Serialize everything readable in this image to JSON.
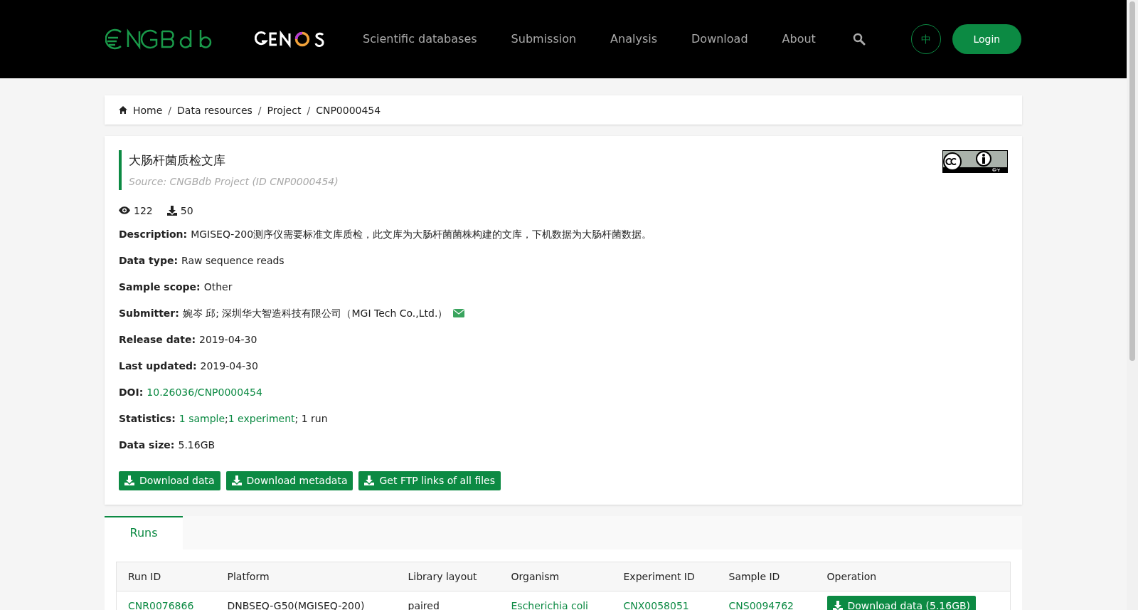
{
  "header": {
    "nav": [
      "Scientific databases",
      "Submission",
      "Analysis",
      "Download",
      "About"
    ],
    "language": "中",
    "login": "Login"
  },
  "breadcrumb": [
    "Home",
    "Data resources",
    "Project",
    "CNP0000454"
  ],
  "breadcrumb_separator": "/",
  "project": {
    "title": "大肠杆菌质检文库",
    "source": "Source: CNGBdb Project (ID CNP0000454)",
    "views": "122",
    "downloads": "50",
    "fields": [
      {
        "label": "Description:",
        "parts": [
          {
            "text": "MGISEQ-200测序仪需要标准文库质检，此文库为大肠杆菌菌株构建的文库，下机数据为大肠杆菌数据。",
            "link": false
          }
        ],
        "email": false
      },
      {
        "label": "Data type:",
        "parts": [
          {
            "text": "Raw sequence reads",
            "link": false
          }
        ],
        "email": false
      },
      {
        "label": "Sample scope:",
        "parts": [
          {
            "text": "Other",
            "link": false
          }
        ],
        "email": false
      },
      {
        "label": "Submitter:",
        "parts": [
          {
            "text": "婉岑 邱; 深圳华大智造科技有限公司（MGI Tech Co.,Ltd.）",
            "link": false
          }
        ],
        "email": true
      },
      {
        "label": "Release date:",
        "parts": [
          {
            "text": "2019-04-30",
            "link": false
          }
        ],
        "email": false
      },
      {
        "label": "Last updated:",
        "parts": [
          {
            "text": "2019-04-30",
            "link": false
          }
        ],
        "email": false
      },
      {
        "label": "DOI:",
        "parts": [
          {
            "text": "10.26036/CNP0000454",
            "link": true
          }
        ],
        "email": false
      },
      {
        "label": "Statistics:",
        "parts": [
          {
            "text": "1 sample",
            "link": true
          },
          {
            "text": ";",
            "link": false
          },
          {
            "text": "1 experiment",
            "link": true
          },
          {
            "text": "; 1 run",
            "link": false
          }
        ],
        "email": false
      },
      {
        "label": "Data size:",
        "parts": [
          {
            "text": "5.16GB",
            "link": false
          }
        ],
        "email": false
      }
    ],
    "buttons": [
      "Download data",
      "Download metadata",
      "Get FTP links of all files"
    ]
  },
  "tabs": [
    {
      "label": "Runs",
      "selected": true
    }
  ],
  "table": {
    "columns": [
      "Run ID",
      "Platform",
      "Library layout",
      "Organism",
      "Experiment ID",
      "Sample ID",
      "Operation"
    ],
    "rows": [
      [
        {
          "text": "CNR0076866",
          "kind": "link"
        },
        {
          "text": "DNBSEQ-G50(MGISEQ-200)",
          "kind": "text"
        },
        {
          "text": "paired",
          "kind": "text"
        },
        {
          "text": "Escherichia coli",
          "kind": "link"
        },
        {
          "text": "CNX0058051",
          "kind": "link"
        },
        {
          "text": "CNS0094762",
          "kind": "link"
        },
        {
          "text": "Download data (5.16GB)",
          "kind": "button"
        }
      ]
    ]
  }
}
